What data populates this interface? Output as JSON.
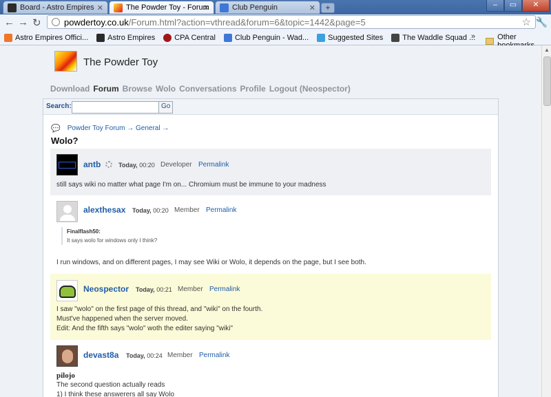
{
  "browser": {
    "tabs": [
      {
        "title": "Board - Astro Empires",
        "active": false
      },
      {
        "title": "The Powder Toy - Forum",
        "active": true
      },
      {
        "title": "Club Penguin",
        "active": false
      }
    ],
    "url_host": "powdertoy.co.uk",
    "url_path": "/Forum.html?action=vthread&forum=6&topic=1442&page=5",
    "bookmarks": [
      "Astro Empires Offici...",
      "Astro Empires",
      "CPA Central",
      "Club Penguin - Wad...",
      "Suggested Sites",
      "The Waddle Squad ..."
    ],
    "bookmarks_more": "»",
    "other_bookmarks": "Other bookmarks"
  },
  "site": {
    "title": "The Powder Toy",
    "nav": [
      "Download",
      "Forum",
      "Browse",
      "Wolo",
      "Conversations",
      "Profile",
      "Logout (Neospector)"
    ],
    "current_nav": "Forum"
  },
  "search": {
    "label": "Search:",
    "value": "",
    "go": "Go"
  },
  "breadcrumb": {
    "forum": "Powder Toy Forum",
    "section": "General",
    "arrow": "→"
  },
  "thread_title": "Wolo?",
  "posts": [
    {
      "user": "antb",
      "day": "Today,",
      "time": "00:20",
      "rank": "Developer",
      "permalink": "Permalink",
      "lines": [
        "still says wiki no matter what page I'm on... Chromium must be immune to your madness"
      ]
    },
    {
      "user": "alexthesax",
      "day": "Today,",
      "time": "00:20",
      "rank": "Member",
      "permalink": "Permalink",
      "quote_author": "Finalflash50:",
      "quote_text": "It says wolo for windows only I think?",
      "lines": [
        "I run windows, and on different pages, I may see Wiki or Wolo, it depends on the page, but I see both."
      ]
    },
    {
      "user": "Neospector",
      "day": "Today,",
      "time": "00:21",
      "rank": "Member",
      "permalink": "Permalink",
      "lines": [
        "I saw \"wolo\" on the first page of this thread, and \"wiki\" on the fourth.",
        "Must've happened when the server moved.",
        "Edit: And the fifth says \"wolo\" woth the editer saying \"wiki\""
      ]
    },
    {
      "user": "devast8a",
      "day": "Today,",
      "time": "00:24",
      "rank": "Member",
      "permalink": "Permalink",
      "lines": [
        "pilojo",
        "The second question actually reads",
        "1) I think these answerers all say Wolo"
      ]
    }
  ],
  "colors": {
    "link": "#1f5ca8",
    "highlight_post": "#fbfbd9",
    "grey_post": "#eef0f3"
  }
}
